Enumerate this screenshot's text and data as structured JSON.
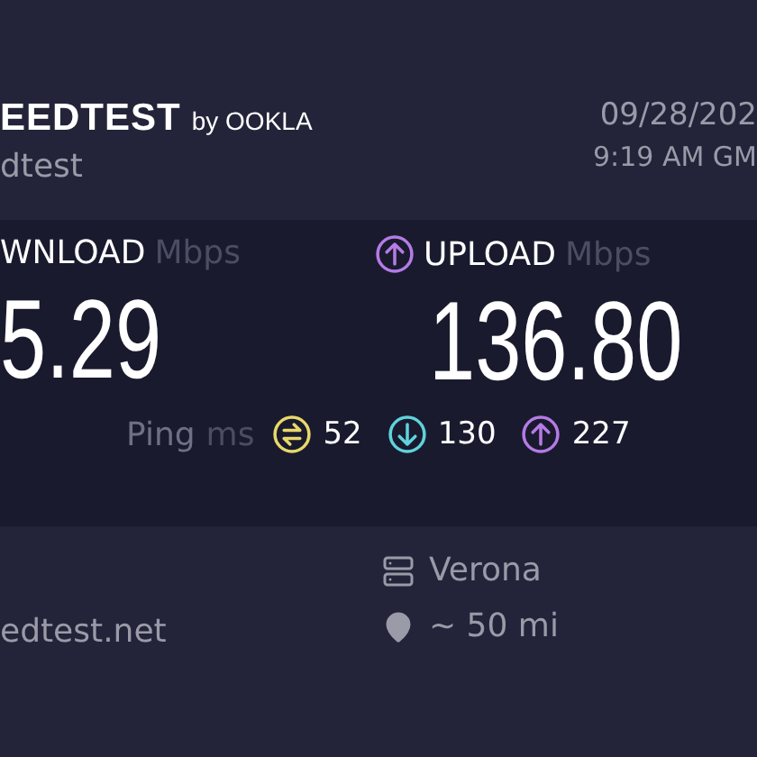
{
  "header": {
    "logo": {
      "main": "EEDTEST",
      "by": "by OOKLA"
    },
    "subtitle": "dtest",
    "date": "09/28/202",
    "time": "9:19 AM GM"
  },
  "results": {
    "download": {
      "label": "WNLOAD",
      "unit": "Mbps",
      "value": "5.29"
    },
    "upload": {
      "label": "UPLOAD",
      "unit": "Mbps",
      "value": "136.80"
    },
    "ping": {
      "label": "Ping",
      "unit": "ms",
      "readings": [
        {
          "kind": "idle",
          "value": "52",
          "color": "#e8d86a"
        },
        {
          "kind": "download",
          "value": "130",
          "color": "#5fd3dc"
        },
        {
          "kind": "upload",
          "value": "227",
          "color": "#b57be6"
        }
      ]
    }
  },
  "server": {
    "host": "edtest.net",
    "name": "Verona",
    "distance": "~ 50 mi"
  }
}
